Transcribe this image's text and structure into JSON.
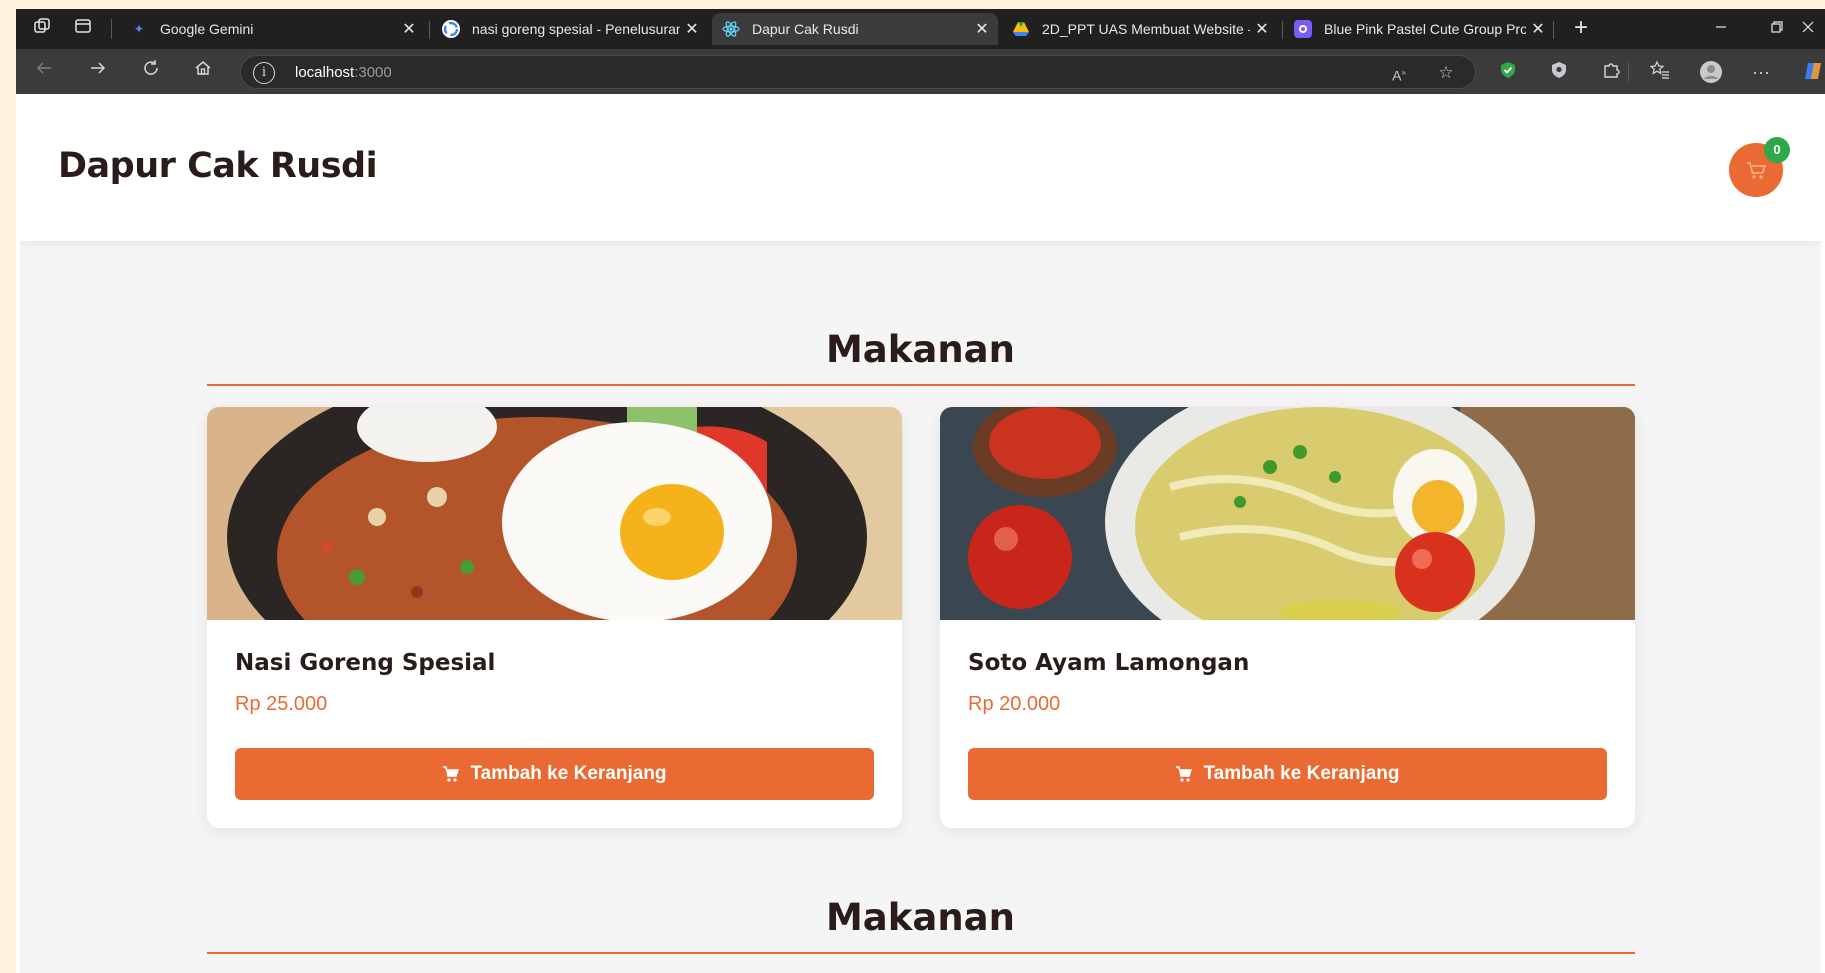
{
  "browser": {
    "tabs": [
      {
        "title": "Google Gemini",
        "favicon": "gemini-icon"
      },
      {
        "title": "nasi goreng spesial - Penelusuran",
        "favicon": "google-icon"
      },
      {
        "title": "Dapur Cak Rusdi",
        "favicon": "react-icon",
        "active": true
      },
      {
        "title": "2D_PPT UAS Membuat Website -",
        "favicon": "google-drive-icon"
      },
      {
        "title": "Blue Pink Pastel Cute Group Proje",
        "favicon": "canva-icon"
      }
    ],
    "address": {
      "host": "localhost",
      "port": ":3000"
    },
    "close_glyph": "✕",
    "new_tab_glyph": "+"
  },
  "site": {
    "brand": "Dapur Cak Rusdi",
    "cart_count": "0",
    "accent_color": "#e96a32",
    "badge_color": "#2ea84a"
  },
  "sections": [
    {
      "title": "Makanan",
      "items": [
        {
          "name": "Nasi Goreng Spesial",
          "price": "Rp 25.000",
          "button": "Tambah ke Keranjang",
          "image": "fried-rice-photo"
        },
        {
          "name": "Soto Ayam Lamongan",
          "price": "Rp 20.000",
          "button": "Tambah ke Keranjang",
          "image": "chicken-soup-photo"
        }
      ]
    },
    {
      "title": "Makanan",
      "items": []
    }
  ]
}
